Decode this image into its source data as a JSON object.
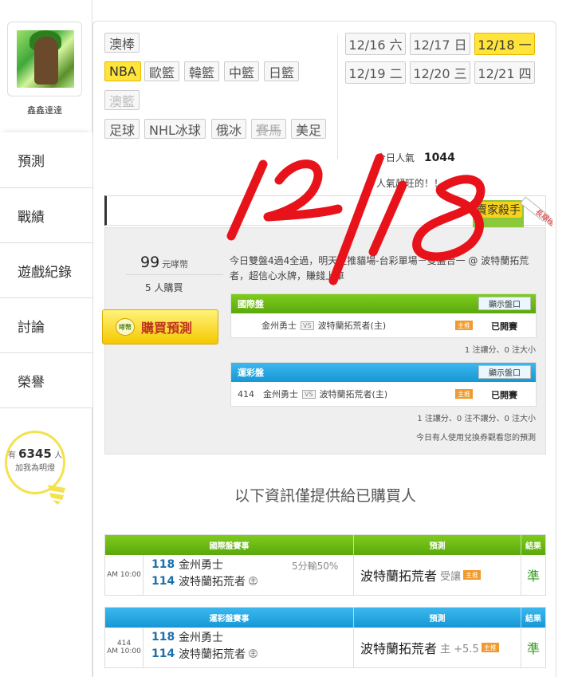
{
  "user": {
    "name": "鑫鑫達達"
  },
  "nav": [
    {
      "label": "預測",
      "active": true
    },
    {
      "label": "戰績",
      "active": false
    },
    {
      "label": "遊戲紀錄",
      "active": false
    },
    {
      "label": "討論",
      "active": false
    },
    {
      "label": "榮譽",
      "active": false
    }
  ],
  "likes": {
    "prefix": "有",
    "count": "6345",
    "unit": "人",
    "caption": "加我為明燈"
  },
  "sports": [
    {
      "label": "澳棒",
      "state": "normal"
    },
    {
      "label": "NBA",
      "state": "on"
    },
    {
      "label": "歐籃",
      "state": "normal"
    },
    {
      "label": "韓籃",
      "state": "normal"
    },
    {
      "label": "中籃",
      "state": "normal"
    },
    {
      "label": "日籃",
      "state": "normal"
    },
    {
      "label": "澳籃",
      "state": "dim"
    },
    {
      "label": "足球",
      "state": "normal"
    },
    {
      "label": "NHL冰球",
      "state": "normal"
    },
    {
      "label": "俄冰",
      "state": "normal"
    },
    {
      "label": "賽馬",
      "state": "strike"
    },
    {
      "label": "美足",
      "state": "normal"
    }
  ],
  "dates": [
    {
      "label": "12/16 六",
      "on": false
    },
    {
      "label": "12/17 日",
      "on": false
    },
    {
      "label": "12/18 一",
      "on": true
    },
    {
      "label": "12/19 二",
      "on": false
    },
    {
      "label": "12/20 三",
      "on": false
    },
    {
      "label": "12/21 四",
      "on": false
    }
  ],
  "popularity": {
    "label": "今日人氣",
    "value": "1044",
    "hot_text": "人氣超旺的！！"
  },
  "expert_badge": {
    "title": "賣家殺手",
    "ribbon": "長期穩定"
  },
  "card": {
    "price": "99",
    "price_unit": "元哮幣",
    "buyers": "5 人購買",
    "buy_label": "購買預測",
    "coin_label": "哮幣",
    "description": "今日雙盤4過4全過，明天主推貓場-台彩單場－雙盤合一 @ 波特蘭拓荒者，超信心水牌，賺錢上車"
  },
  "markets": [
    {
      "title": "國際盤",
      "color": "green",
      "show_label": "顯示盤口",
      "code": "",
      "away": "金州勇士",
      "vs": "VS",
      "home": "波特蘭拓荒者(主)",
      "badge": "主推",
      "status": "已開賽",
      "note": "1 注讓分、0 注大小"
    },
    {
      "title": "運彩盤",
      "color": "blue",
      "show_label": "顯示盤口",
      "code": "414",
      "away": "金州勇士",
      "vs": "VS",
      "home": "波特蘭拓荒者(主)",
      "badge": "主推",
      "status": "已開賽",
      "note": "1 注讓分、0 注不讓分、0 注大小"
    }
  ],
  "voucher_note": "今日有人使用兌換券觀看您的預測",
  "info_title": "以下資訊僅提供給已購買人",
  "results": [
    {
      "headers": [
        "國際盤賽事",
        "預測",
        "結果"
      ],
      "color": "green",
      "code": "",
      "time": "AM 10:00",
      "away_code": "118",
      "away": "金州勇士",
      "home_code": "114",
      "home": "波特蘭拓荒者",
      "home_mark": "主",
      "spread": "5分輸50%",
      "pick": "波特蘭拓荒者",
      "pick_extra": "受讓",
      "badge": "主推",
      "result": "準"
    },
    {
      "headers": [
        "運彩盤賽事",
        "預測",
        "結果"
      ],
      "color": "blue",
      "code": "414",
      "time": "AM 10:00",
      "away_code": "118",
      "away": "金州勇士",
      "home_code": "114",
      "home": "波特蘭拓荒者",
      "home_mark": "主",
      "spread": "",
      "pick": "波特蘭拓荒者",
      "pick_extra": "主 +5.5",
      "badge": "主推",
      "result": "準"
    }
  ],
  "annotation": {
    "text": "12/18",
    "color": "#e8131a"
  }
}
